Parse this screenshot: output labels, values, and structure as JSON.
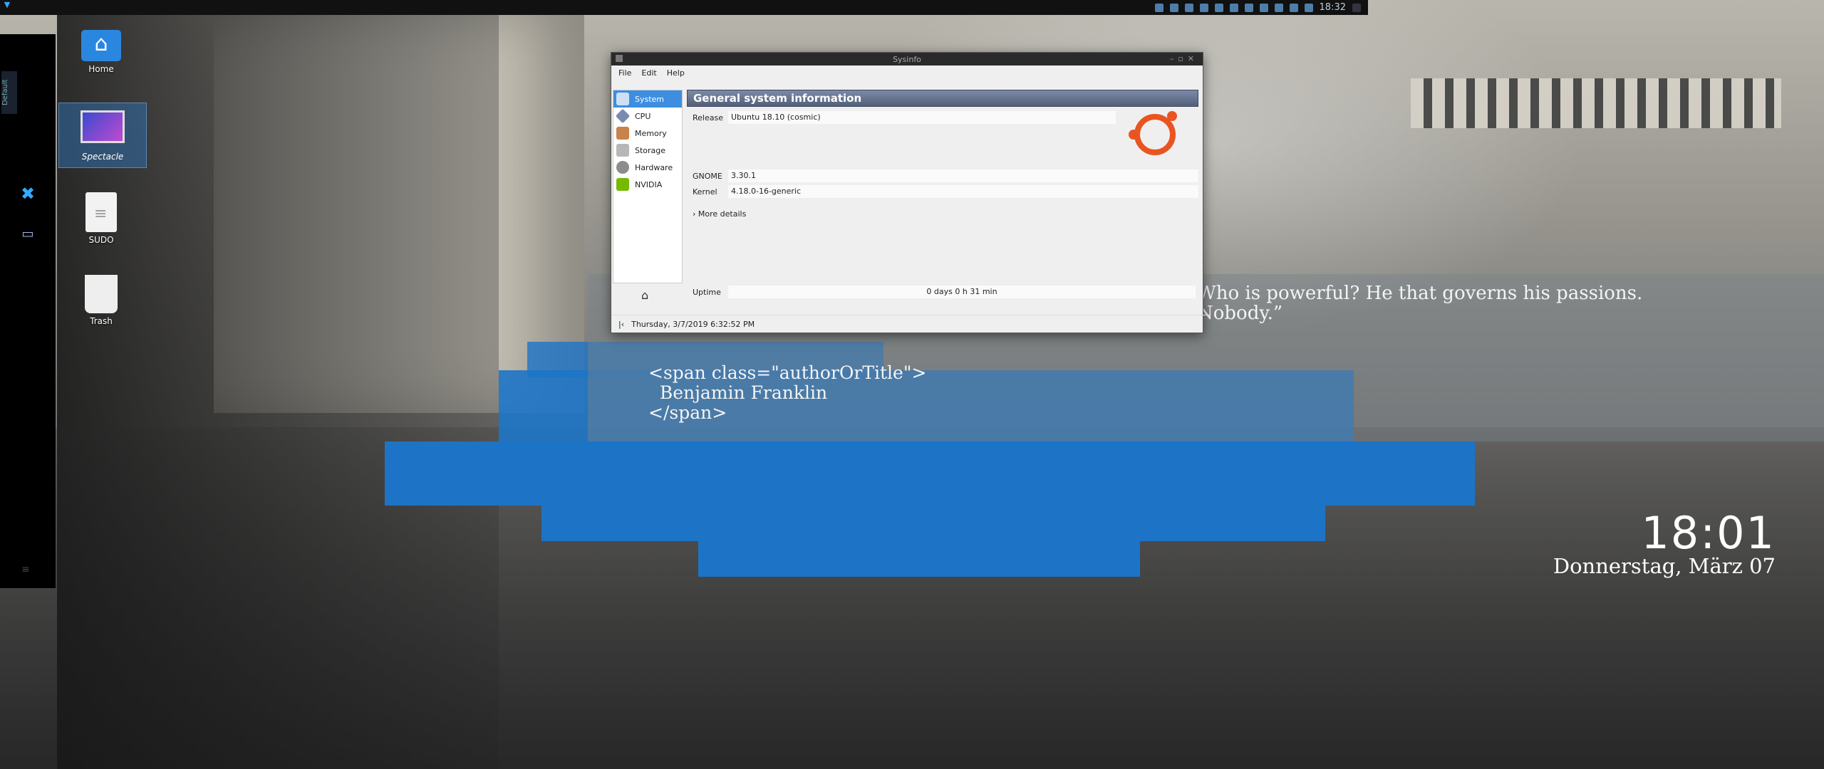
{
  "wallpaper": {
    "quote": "Who is powerful? He that governs his passions.\nNobody.”",
    "author": "<span class=\"authorOrTitle\">\n  Benjamin Franklin\n</span>",
    "clock": "18:01",
    "date": "Donnerstag, März 07"
  },
  "top_panel": {
    "time": "18:32"
  },
  "dock": {
    "tab_label": "Default"
  },
  "desktop": {
    "icons": [
      {
        "label": "Home"
      },
      {
        "label": "Spectacle"
      },
      {
        "label": "SUDO"
      },
      {
        "label": "Trash"
      }
    ]
  },
  "window": {
    "title": "Sysinfo",
    "menu": [
      "File",
      "Edit",
      "Help"
    ],
    "sidebar": [
      "System",
      "CPU",
      "Memory",
      "Storage",
      "Hardware",
      "NVIDIA"
    ],
    "header": "General system information",
    "release_label": "Release",
    "release_value": "Ubuntu 18.10 (cosmic)",
    "gnome_label": "GNOME",
    "gnome_value": "3.30.1",
    "kernel_label": "Kernel",
    "kernel_value": "4.18.0-16-generic",
    "more_details": "More details",
    "uptime_label": "Uptime",
    "uptime_value": "0 days 0 h 31 min",
    "status_datetime": "Thursday, 3/7/2019 6:32:52 PM"
  }
}
